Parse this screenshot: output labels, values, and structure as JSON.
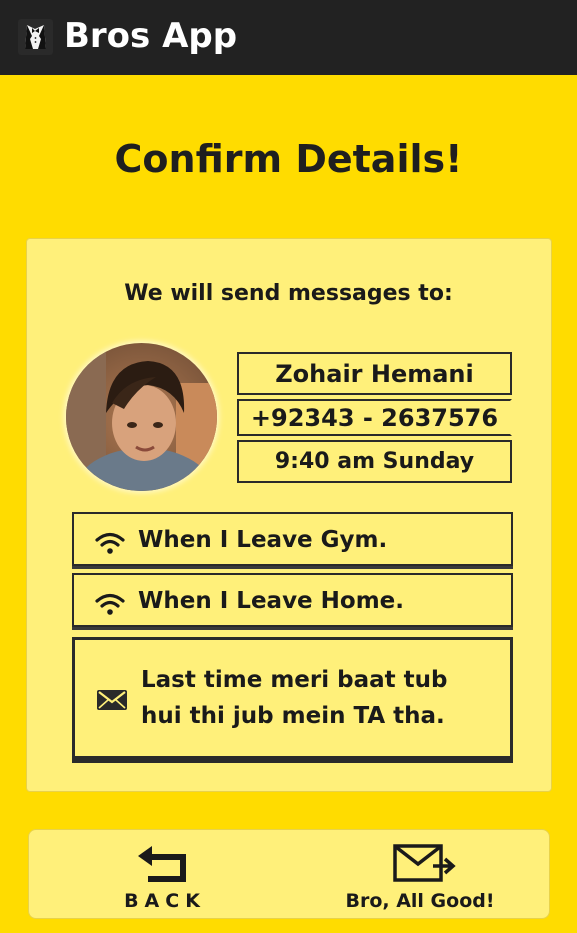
{
  "app": {
    "title": "Bros App",
    "icon": "tuxedo-icon"
  },
  "page": {
    "title": "Confirm Details!"
  },
  "card": {
    "heading": "We will send messages to:",
    "contact": {
      "name": "Zohair Hemani",
      "phone": "+92343 - 2637576",
      "time": "9:40 am Sunday",
      "avatar": "contact-photo"
    },
    "triggers": [
      {
        "icon": "wifi-icon",
        "label": "When I Leave Gym."
      },
      {
        "icon": "wifi-icon",
        "label": "When I Leave Home."
      }
    ],
    "message": {
      "icon": "envelope-icon",
      "text": "Last time meri baat tub hui thi jub mein TA tha."
    }
  },
  "actions": {
    "back_label": "BACK",
    "confirm_label": "Bro, All Good!"
  },
  "colors": {
    "background": "#FFDC00",
    "card": "#FFF07A",
    "appbar": "#222222",
    "text": "#1a1a1a"
  }
}
